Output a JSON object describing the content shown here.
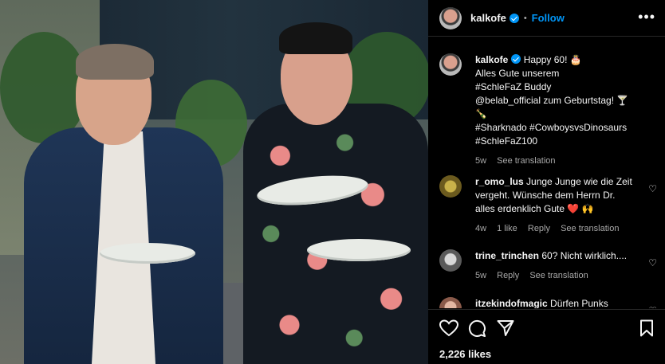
{
  "post": {
    "username": "kalkofe",
    "verified": true,
    "follow_label": "Follow",
    "more_icon": "more-horizontal-icon",
    "caption_lines": [
      "Happy 60! 🎂",
      "Alles Gute unserem",
      "#SchleFaZ Buddy",
      "@belab_official zum Geburtstag! 🍸",
      "🍾",
      "#Sharknado #CowboysvsDinosaurs",
      "#SchleFaZ100"
    ],
    "caption_time": "5w",
    "caption_see_translation": "See translation"
  },
  "comments": [
    {
      "username": "r_omo_lus",
      "text": "Junge Junge wie die Zeit vergeht. Wünsche dem Herrn Dr. alles erdenklich Gute ❤️ 🙌",
      "time": "4w",
      "likes": "1 like",
      "reply": "Reply",
      "see_translation": "See translation"
    },
    {
      "username": "trine_trinchen",
      "text": "60? Nicht wirklich....",
      "time": "5w",
      "reply": "Reply",
      "see_translation": "See translation"
    },
    {
      "username": "itzekindofmagic",
      "text": "Dürfen Punks"
    }
  ],
  "actions": {
    "like_icon": "heart-icon",
    "comment_icon": "comment-icon",
    "share_icon": "share-icon",
    "save_icon": "bookmark-icon"
  },
  "likes_count": "2,226 likes",
  "colors": {
    "background": "#000000",
    "text": "#f5f5f5",
    "muted": "#a8a8a8",
    "follow": "#0095f6",
    "verified": "#0095f6"
  }
}
